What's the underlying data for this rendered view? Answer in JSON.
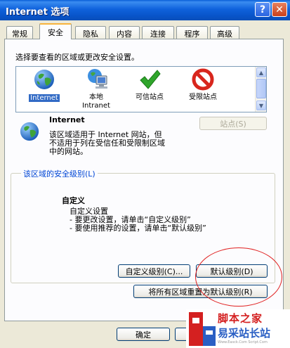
{
  "window": {
    "title": "Internet 选项",
    "help_glyph": "?",
    "close_glyph": "✕"
  },
  "tabs": [
    {
      "label": "常规"
    },
    {
      "label": "安全",
      "active": true
    },
    {
      "label": "隐私"
    },
    {
      "label": "内容"
    },
    {
      "label": "连接"
    },
    {
      "label": "程序"
    },
    {
      "label": "高级"
    }
  ],
  "security": {
    "prompt": "选择要查看的区域或更改安全设置。",
    "zones": [
      {
        "label_line1": "Internet",
        "label_line2": "",
        "icon": "globe-icon",
        "selected": true
      },
      {
        "label_line1": "本地",
        "label_line2": "Intranet",
        "icon": "computer-network-icon"
      },
      {
        "label_line1": "可信站点",
        "label_line2": "",
        "icon": "checkmark-icon"
      },
      {
        "label_line1": "受限站点",
        "label_line2": "",
        "icon": "no-entry-icon"
      }
    ],
    "zone_title": "Internet",
    "zone_description": [
      "该区域适用于 Internet 网站，但",
      "不适用于列在受信任和受限制区域",
      "中的网站。"
    ],
    "sites_button": "站点(S)",
    "level_group_title": "该区域的安全级别(L)",
    "custom_title": "自定义",
    "custom_lines": [
      "自定义设置",
      "- 要更改设置，请单击“自定义级别”",
      "- 要使用推荐的设置，请单击“默认级别”"
    ],
    "custom_level_button": "自定义级别(C)...",
    "default_level_button": "默认级别(D)",
    "reset_all_button": "将所有区域重置为默认级别(R)"
  },
  "footer": {
    "ok_button": "确定"
  },
  "watermark": {
    "line1": "脚本之家",
    "line2": "易采站长站",
    "line3": "Www.Easck.Com  Script.Com"
  },
  "colors": {
    "titlebar": "#0f62dc",
    "accent_tab": "#f7b33d",
    "group_title": "#0046d5",
    "annotation_ellipse": "#e02020"
  }
}
